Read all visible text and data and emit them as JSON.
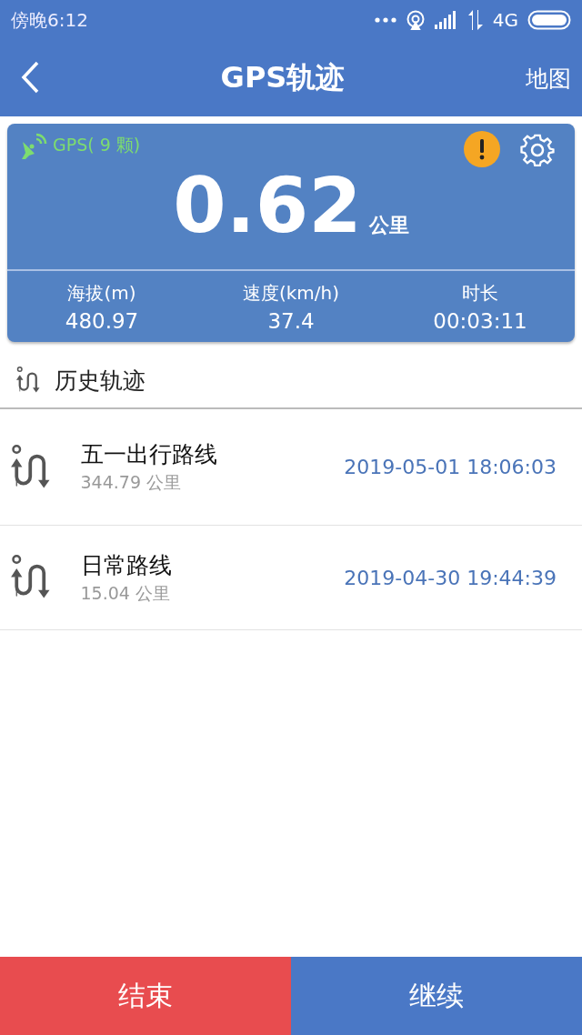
{
  "status_bar": {
    "time": "傍晚6:12",
    "network": "4G"
  },
  "toolbar": {
    "title": "GPS轨迹",
    "action": "地图"
  },
  "summary": {
    "gps": "GPS( 9 颗)",
    "distance": "0.62",
    "unit": "公里",
    "alert": true,
    "stats": [
      {
        "label": "海拔(m)",
        "value": "480.97"
      },
      {
        "label": "速度(km/h)",
        "value": "37.4"
      },
      {
        "label": "时长",
        "value": "00:03:11"
      }
    ]
  },
  "history": {
    "title": "历史轨迹",
    "items": [
      {
        "name": "五一出行路线",
        "distance": "344.79 公里",
        "time": "2019-05-01 18:06:03"
      },
      {
        "name": "日常路线",
        "distance": "15.04 公里",
        "time": "2019-04-30 19:44:39"
      }
    ]
  },
  "buttons": [
    {
      "label": "结束",
      "color": "#e84c4f"
    },
    {
      "label": "继续",
      "color": "#4a78c6"
    }
  ]
}
